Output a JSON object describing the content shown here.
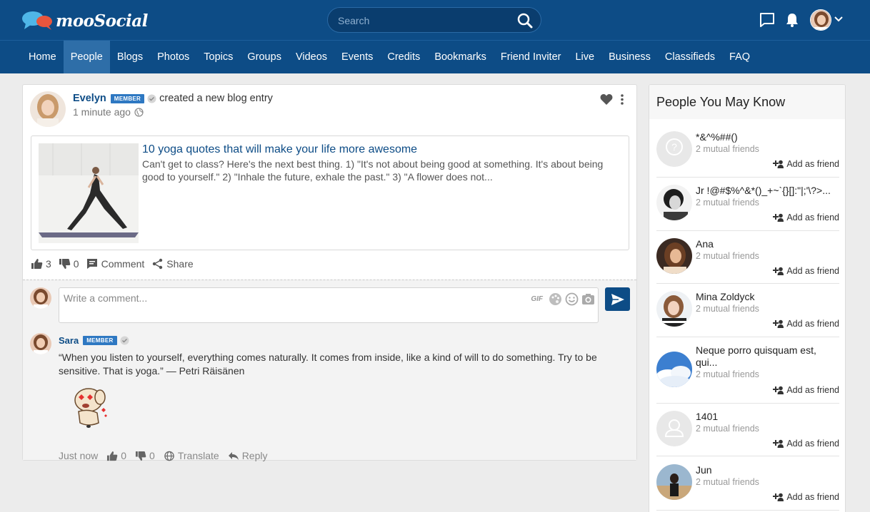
{
  "header": {
    "brand": "mooSocial",
    "search_placeholder": "Search",
    "icons": [
      "logo-bubbles-icon",
      "search-icon",
      "message-icon",
      "bell-icon",
      "chevron-down-icon"
    ],
    "accent": "#0d4c86"
  },
  "nav": {
    "items": [
      "Home",
      "People",
      "Blogs",
      "Photos",
      "Topics",
      "Groups",
      "Videos",
      "Events",
      "Credits",
      "Bookmarks",
      "Friend Inviter",
      "Live",
      "Business",
      "Classifieds",
      "FAQ"
    ],
    "active": "People"
  },
  "post": {
    "author": "Evelyn",
    "badge": "MEMBER",
    "action": "created a new blog entry",
    "time": "1 minute ago",
    "blog": {
      "title": "10 yoga quotes that will make your life more awesome",
      "excerpt": "Can't get to class? Here's the next best thing. 1) \"It's not about being good at something. It's about being good to yourself.\" 2) \"Inhale the future, exhale the past.\" 3) \"A flower does not..."
    },
    "likes": "3",
    "dislikes": "0",
    "comment_label": "Comment",
    "share_label": "Share"
  },
  "comment_box": {
    "placeholder": "Write a comment...",
    "gif_label": "GIF"
  },
  "comment": {
    "author": "Sara",
    "badge": "MEMBER",
    "text": "“When you listen to yourself, everything comes naturally. It comes from inside, like a kind of will to do something. Try to be sensitive. That is yoga.” — Petri Räisänen",
    "time": "Just now",
    "likes": "0",
    "dislikes": "0",
    "translate_label": "Translate",
    "reply_label": "Reply"
  },
  "widget": {
    "title": "People You May Know",
    "add_label": "Add as friend",
    "people": [
      {
        "name": "*&^%##()",
        "mutual": "2 mutual friends"
      },
      {
        "name": "Jr !@#$%^&*()_+~`{}[]:\"|;'\\?>...",
        "mutual": "2 mutual friends"
      },
      {
        "name": "Ana",
        "mutual": "2 mutual friends"
      },
      {
        "name": "Mina Zoldyck",
        "mutual": "2 mutual friends"
      },
      {
        "name": "Neque porro quisquam est, qui...",
        "mutual": "2 mutual friends"
      },
      {
        "name": "1401",
        "mutual": "2 mutual friends"
      },
      {
        "name": "Jun",
        "mutual": "2 mutual friends"
      }
    ]
  }
}
